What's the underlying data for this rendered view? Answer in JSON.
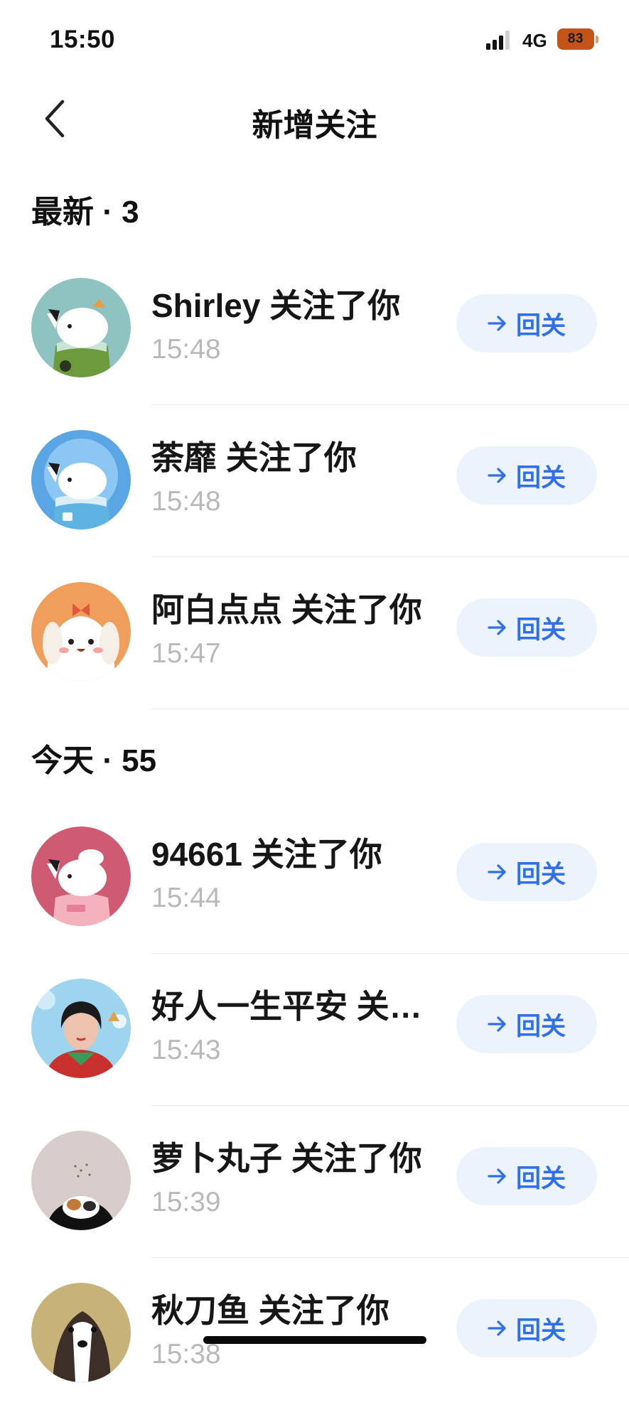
{
  "status_bar": {
    "time": "15:50",
    "network": "4G",
    "battery": "83",
    "battery_color": "#c15416"
  },
  "nav": {
    "back_icon": "chevron-left-icon",
    "title": "新增关注"
  },
  "sections": [
    {
      "header": "最新 · 3",
      "rows": [
        {
          "name": "Shirley 关注了你",
          "time": "15:48",
          "button": "回关",
          "avatar": "puppy-green"
        },
        {
          "name": "荼靡 关注了你",
          "time": "15:48",
          "button": "回关",
          "avatar": "puppy-astronaut"
        },
        {
          "name": "阿白点点 关注了你",
          "time": "15:47",
          "button": "回关",
          "avatar": "cartoon-puppy-orange"
        }
      ]
    },
    {
      "header": "今天 · 55",
      "rows": [
        {
          "name": "94661 关注了你",
          "time": "15:44",
          "button": "回关",
          "avatar": "puppy-chef"
        },
        {
          "name": "好人一生平安 关…",
          "time": "15:43",
          "button": "回关",
          "avatar": "photo-woman"
        },
        {
          "name": "萝卜丸子 关注了你",
          "time": "15:39",
          "button": "回关",
          "avatar": "photo-hamster"
        },
        {
          "name": "秋刀鱼 关注了你",
          "time": "15:38",
          "button": "回关",
          "avatar": "photo-dog"
        }
      ]
    }
  ],
  "colors": {
    "accent": "#2f6fe8",
    "button_bg": "#edf3fd",
    "time_gray": "#b9b9b9"
  }
}
